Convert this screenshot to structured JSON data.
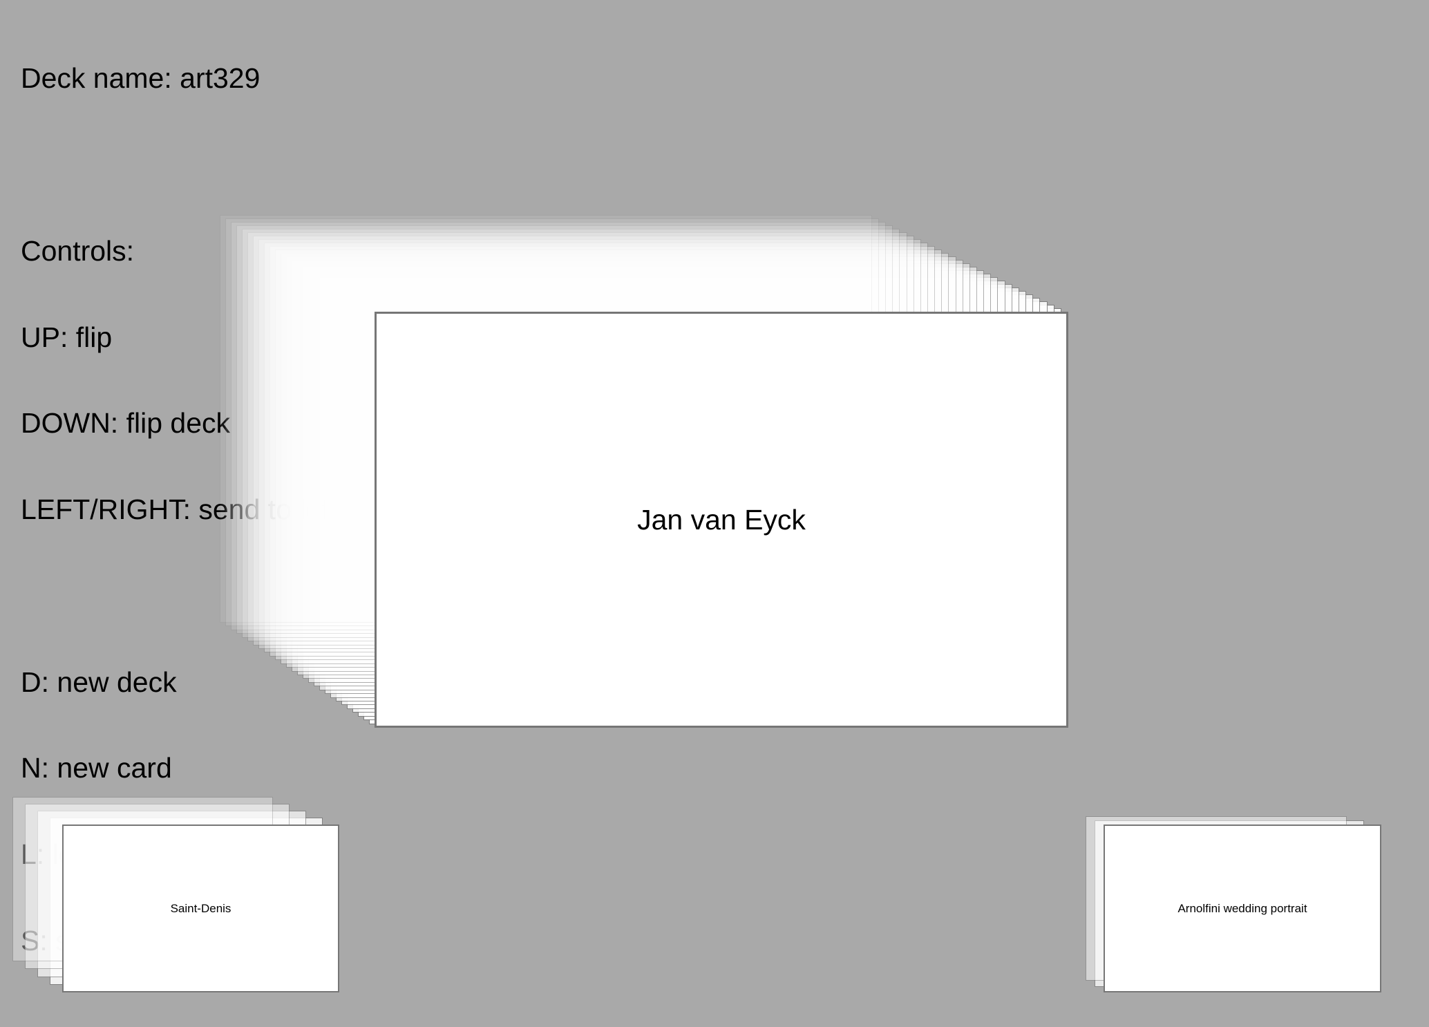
{
  "deck": {
    "name_line": "Deck name: art329"
  },
  "controls": {
    "heading": "Controls:",
    "up": "UP: flip",
    "down": "DOWN: flip deck",
    "left_right": "LEFT/RIGHT: send to left/right pile",
    "d": "D: new deck",
    "n": "N: new card",
    "l": "L: load deck",
    "s": "S: save deck"
  },
  "current_card": {
    "text": "Jan van Eyck",
    "stack_depth": 28
  },
  "left_pile": {
    "top_card_text": "Saint-Denis",
    "stack_depth": 4
  },
  "right_pile": {
    "top_card_text": "Arnolfini wedding portrait",
    "stack_depth": 2
  },
  "colors": {
    "background": "#a9a9a9",
    "card": "#ffffff",
    "card_border": "#767676"
  }
}
